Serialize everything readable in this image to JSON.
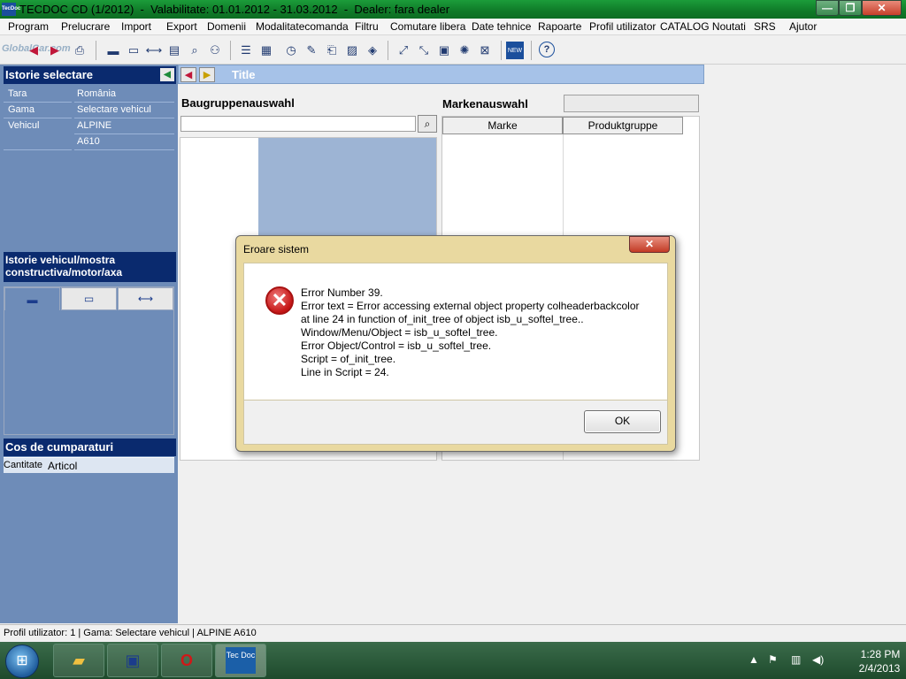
{
  "window": {
    "title": "TECDOC CD (1/2012)  -  Valabilitate: 01.01.2012 - 31.03.2012  -  Dealer: fara dealer",
    "app_icon_text": "TecDoc",
    "minimize": "—",
    "restore": "❐",
    "close": "✕"
  },
  "menu": [
    "Program",
    "Prelucrare",
    "Import",
    "Export",
    "Domenii",
    "Modalitatecomanda",
    "Filtru",
    "Comutare libera",
    "Date tehnice",
    "Rapoarte",
    "Profil utilizator",
    "CATALOG Noutati",
    "SRS",
    "Ajutor"
  ],
  "toolbar": {
    "watermark": "GlobalCar.com",
    "icons": [
      "back-arrow-icon",
      "forward-arrow-icon",
      "print-icon",
      "car-icon",
      "engine-icon",
      "axle-icon",
      "truck-icon",
      "search-icon",
      "person-search-icon",
      "list-icon",
      "table-icon",
      "clock-icon",
      "tools-icon",
      "document-icon",
      "image-icon",
      "book-icon",
      "chart-icon",
      "edit-icon",
      "calc-icon",
      "wheel-icon",
      "parts-icon",
      "new-icon",
      "help-icon"
    ],
    "help_label": "?",
    "new_label": "NEW"
  },
  "left_panel": {
    "history_header": "Istorie selectare",
    "history_rows": [
      {
        "key": "Tara",
        "value": "România"
      },
      {
        "key": "Gama",
        "value": "Selectare vehicul"
      },
      {
        "key": "Vehicul",
        "value": "ALPINE"
      },
      {
        "key": "",
        "value": "A610"
      }
    ],
    "vehicle_history_header": "Istorie vehicul/mostra constructiva/motor/axa",
    "tabs": [
      "car-icon",
      "engine-icon",
      "axle-icon"
    ],
    "cart_header": "Cos de cumparaturi",
    "cart_columns": [
      "Cantitate",
      "Articol"
    ]
  },
  "main": {
    "title": "Title",
    "baugruppe_label": "Baugruppenauswahl",
    "marken_label": "Markenauswahl",
    "marken_columns": [
      "Marke",
      "Produktgruppe"
    ]
  },
  "dialog": {
    "title": "Eroare sistem",
    "close_label": "✕",
    "lines": [
      "Error Number 39.",
      "Error text = Error accessing external object property colheaderbackcolor",
      "at line 24 in function of_init_tree of object isb_u_softel_tree..",
      "Window/Menu/Object = isb_u_softel_tree.",
      "Error Object/Control = isb_u_softel_tree.",
      "Script = of_init_tree.",
      "Line in Script = 24."
    ],
    "ok_label": "OK"
  },
  "status_bar": "Profil utilizator: 1 | Gama: Selectare vehicul | ALPINE A610",
  "taskbar": {
    "tecdoc_badge": "Tec Doc",
    "time": "1:28 PM",
    "date": "2/4/2013"
  }
}
